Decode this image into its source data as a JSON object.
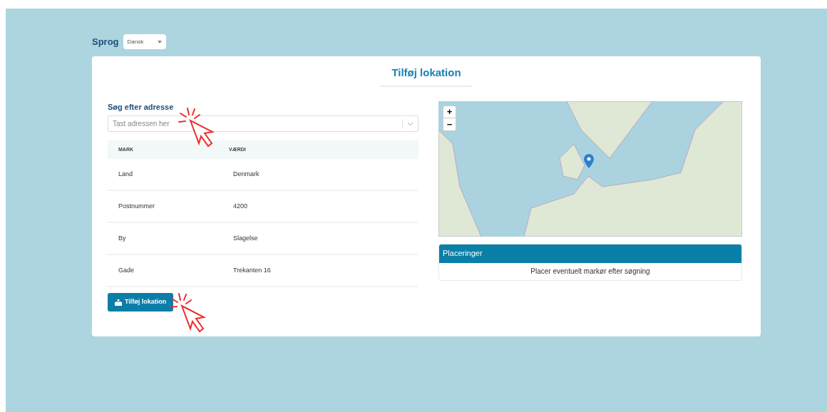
{
  "language": {
    "label": "Sprog",
    "value": "Dansk"
  },
  "title": "Tilføj lokation",
  "search": {
    "label": "Søg efter adresse",
    "placeholder": "Tast adressen her"
  },
  "table": {
    "columns": [
      "MARK",
      "VÆRDI"
    ],
    "rows": [
      {
        "field": "Land",
        "value": "Denmark"
      },
      {
        "field": "Postnummer",
        "value": "4200"
      },
      {
        "field": "By",
        "value": "Slagelse"
      },
      {
        "field": "Gade",
        "value": "Trekanten 16"
      }
    ]
  },
  "add_button": "Tilføj lokation",
  "map": {
    "zoom_in": "+",
    "zoom_out": "−"
  },
  "locations": {
    "header": "Placeringer",
    "message": "Placer eventuelt markør efter søgning"
  }
}
